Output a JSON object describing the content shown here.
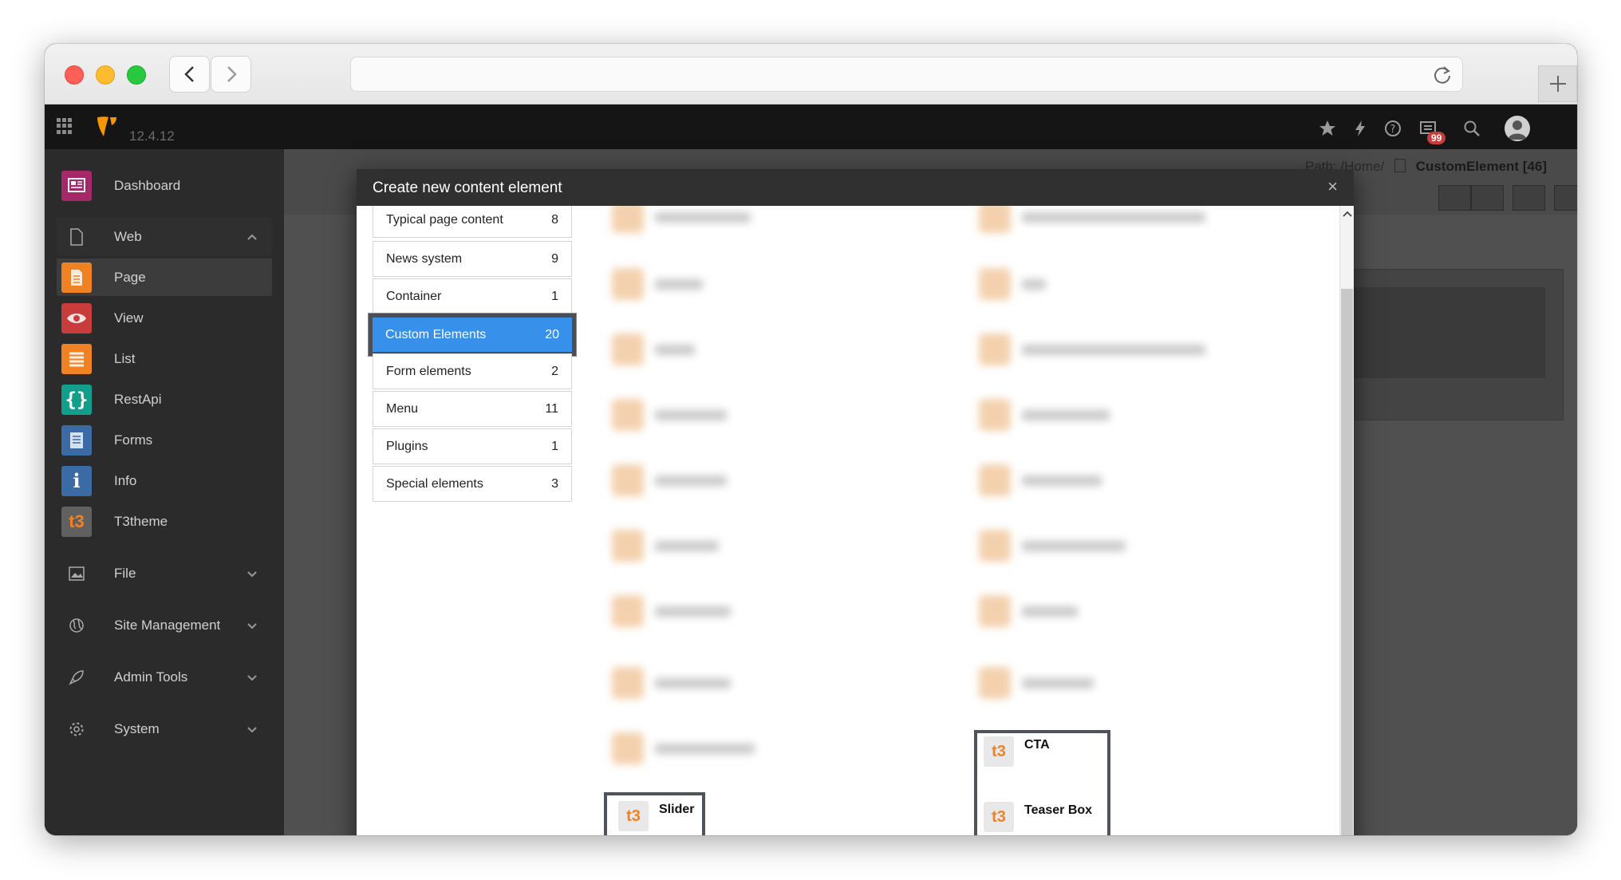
{
  "app": {
    "version": "12.4.12",
    "notification_count": "99"
  },
  "sidebar": {
    "modules": [
      {
        "label": "Dashboard",
        "icon": "dashboard-icon",
        "color": "#a52869"
      },
      {
        "label": "Web",
        "icon": "page-icon",
        "group": true
      },
      {
        "label": "Page",
        "icon": "page-module-icon",
        "color": "#f08224",
        "active": true
      },
      {
        "label": "View",
        "icon": "eye-icon",
        "color": "#c83c3c"
      },
      {
        "label": "List",
        "icon": "list-icon",
        "color": "#f08224"
      },
      {
        "label": "RestApi",
        "icon": "braces-icon",
        "color": "#119e8a"
      },
      {
        "label": "Forms",
        "icon": "forms-icon",
        "color": "#3b6ba5"
      },
      {
        "label": "Info",
        "icon": "info-icon",
        "color": "#3b6ba5"
      },
      {
        "label": "T3theme",
        "icon": "t3-icon",
        "color": "#606060"
      },
      {
        "label": "File",
        "icon": "image-icon",
        "group": true
      },
      {
        "label": "Site Management",
        "icon": "globe-icon",
        "group": true
      },
      {
        "label": "Admin Tools",
        "icon": "rocket-icon",
        "group": true
      },
      {
        "label": "System",
        "icon": "cog-icon",
        "group": true
      }
    ]
  },
  "docheader": {
    "path_prefix": "Path: /Home/",
    "page_title": "CustomElement [46]"
  },
  "modal": {
    "title": "Create new content element",
    "close": "×",
    "categories": [
      {
        "label": "Typical page content",
        "count": "8"
      },
      {
        "label": "News system",
        "count": "9"
      },
      {
        "label": "Container",
        "count": "1"
      },
      {
        "label": "Custom Elements",
        "count": "20",
        "active": true
      },
      {
        "label": "Form elements",
        "count": "2"
      },
      {
        "label": "Menu",
        "count": "11"
      },
      {
        "label": "Plugins",
        "count": "1"
      },
      {
        "label": "Special elements",
        "count": "3"
      }
    ],
    "elements": {
      "slider": "Slider",
      "cta": "CTA",
      "teaser_box": "Teaser Box"
    }
  },
  "colors": {
    "accent": "#3790ea",
    "modal_header": "#303030",
    "highlight_border": "#4e535c",
    "t3_orange": "#f08224"
  }
}
